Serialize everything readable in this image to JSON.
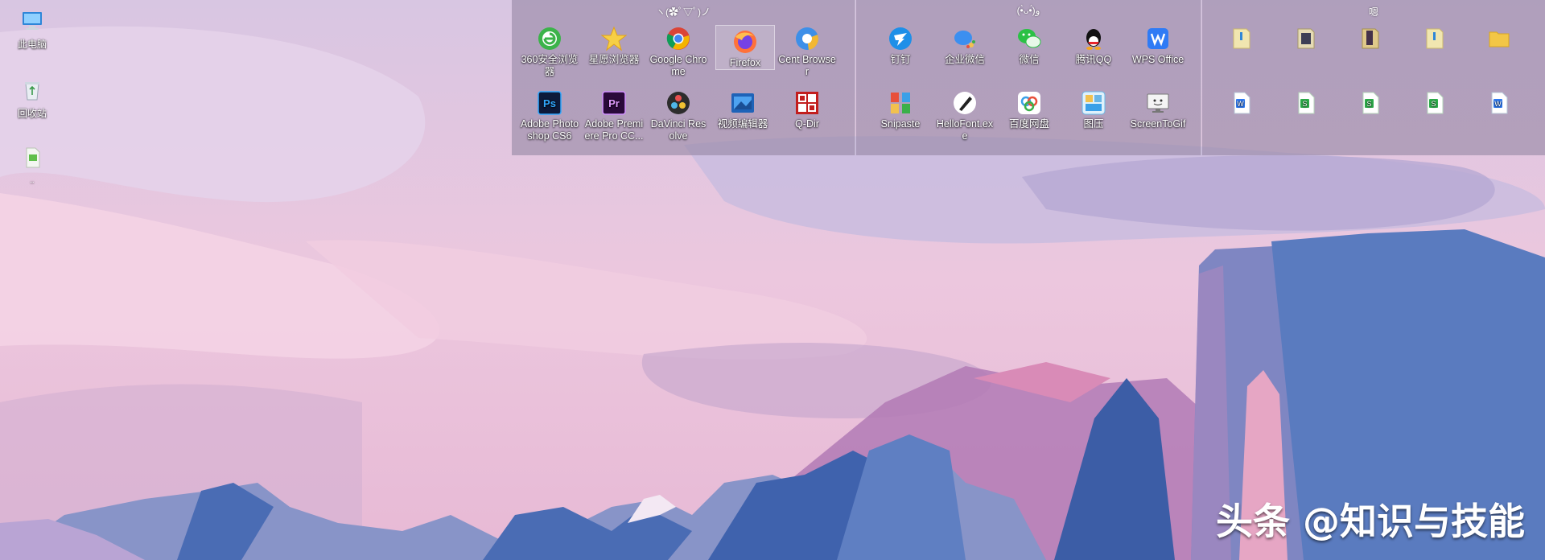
{
  "desktop_icons": [
    {
      "label": "此电脑",
      "icon": "computer-icon"
    },
    {
      "label": "回收站",
      "icon": "recycle-bin-icon"
    },
    {
      "label": "..",
      "icon": "document-icon"
    }
  ],
  "fences": [
    {
      "title": "ヽ(✿ﾟ▽ﾟ)ノ",
      "items": [
        {
          "label": "360安全浏览器",
          "icon": "360-browser-icon"
        },
        {
          "label": "星愿浏览器",
          "icon": "star-browser-icon"
        },
        {
          "label": "Google Chrome",
          "icon": "chrome-icon"
        },
        {
          "label": "Firefox",
          "icon": "firefox-icon",
          "selected": true
        },
        {
          "label": "Cent Browser",
          "icon": "cent-browser-icon"
        },
        {
          "label": "Adobe Photoshop CS6",
          "icon": "photoshop-icon"
        },
        {
          "label": "Adobe Premiere Pro CC...",
          "icon": "premiere-icon"
        },
        {
          "label": "DaVinci Resolve",
          "icon": "davinci-icon"
        },
        {
          "label": "视频编辑器",
          "icon": "video-editor-icon"
        },
        {
          "label": "Q-Dir",
          "icon": "qdir-icon"
        }
      ]
    },
    {
      "title": "(•̀ᴗ•́)و",
      "items": [
        {
          "label": "钉钉",
          "icon": "dingtalk-icon"
        },
        {
          "label": "企业微信",
          "icon": "wecom-icon"
        },
        {
          "label": "微信",
          "icon": "wechat-icon"
        },
        {
          "label": "腾讯QQ",
          "icon": "qq-icon"
        },
        {
          "label": "WPS Office",
          "icon": "wps-icon"
        },
        {
          "label": "Snipaste",
          "icon": "snipaste-icon"
        },
        {
          "label": "HelloFont.exe",
          "icon": "hellofont-icon"
        },
        {
          "label": "百度网盘",
          "icon": "baidu-netdisk-icon"
        },
        {
          "label": "图压",
          "icon": "tuya-icon"
        },
        {
          "label": "ScreenToGif",
          "icon": "screentogif-icon"
        }
      ]
    },
    {
      "title": "嗯",
      "items": [
        {
          "label": "",
          "icon": "folder-icon"
        },
        {
          "label": "",
          "icon": "folder-icon"
        },
        {
          "label": "",
          "icon": "folder-icon"
        },
        {
          "label": "",
          "icon": "folder-icon"
        },
        {
          "label": "",
          "icon": "folder-icon"
        },
        {
          "label": "",
          "icon": "word-doc-icon"
        },
        {
          "label": "",
          "icon": "sheet-doc-icon"
        },
        {
          "label": "",
          "icon": "sheet-doc-icon"
        },
        {
          "label": "",
          "icon": "sheet-doc-icon"
        },
        {
          "label": "",
          "icon": "word-doc-icon"
        }
      ]
    }
  ],
  "watermark": "头条 @知识与技能",
  "colors": {
    "sky_top": "#d9c8e3",
    "sky_pink": "#f0c6da",
    "mountain_blue": "#5577bb",
    "mountain_pink": "#e39ab8",
    "fence_bg": "#9687a5"
  }
}
